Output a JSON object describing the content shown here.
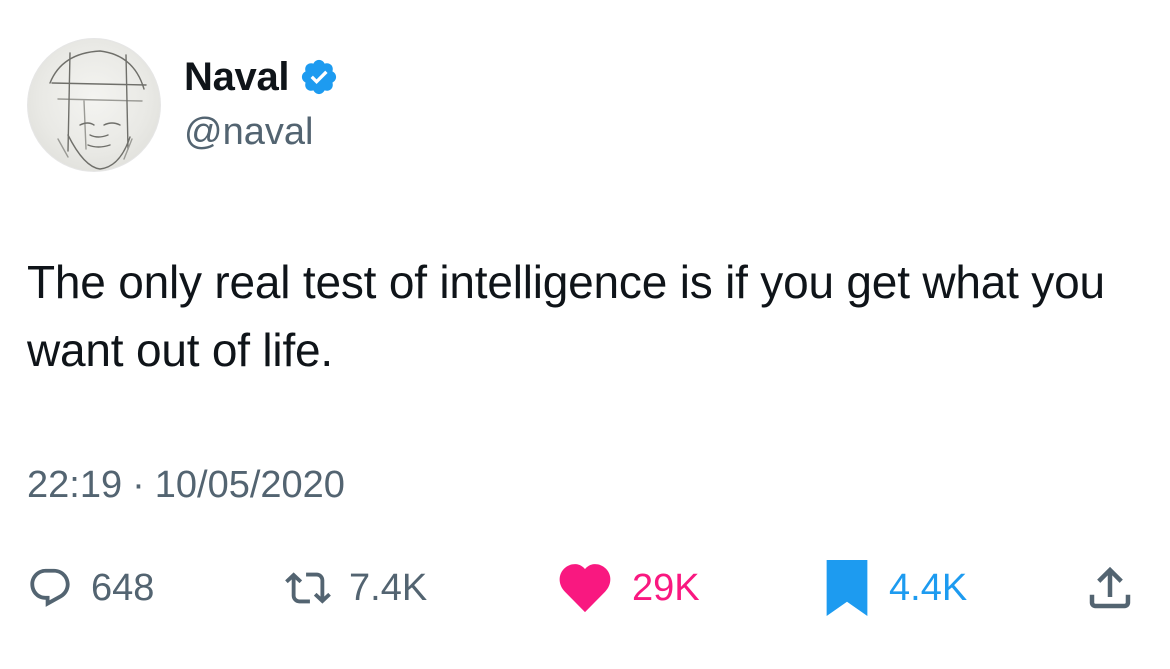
{
  "author": {
    "name": "Naval",
    "handle": "@naval",
    "verified": true,
    "avatar_icon": "sketched-face-avatar"
  },
  "tweet": {
    "text": "The only real test of intelligence is if you get what you want out of life."
  },
  "meta": {
    "time": "22:19",
    "separator": "·",
    "date": "10/05/2020"
  },
  "actions": {
    "reply": {
      "icon": "reply-bubble-icon",
      "count": "648"
    },
    "retweet": {
      "icon": "retweet-icon",
      "count": "7.4K"
    },
    "like": {
      "icon": "heart-filled-icon",
      "count": "29K"
    },
    "bookmark": {
      "icon": "bookmark-filled-icon",
      "count": "4.4K"
    },
    "share": {
      "icon": "share-upload-icon"
    }
  },
  "colors": {
    "text": "#0f1419",
    "secondary": "#536471",
    "like": "#f91880",
    "bookmark": "#1d9bf0",
    "verified": "#1d9bf0"
  }
}
